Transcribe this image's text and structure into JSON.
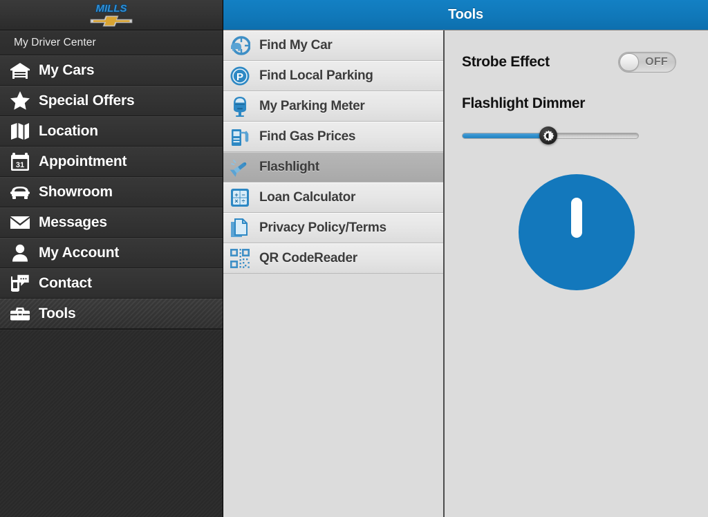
{
  "sidebar": {
    "logo": {
      "brand_text": "MILLS",
      "emblem": "chevrolet-bowtie-icon"
    },
    "header_label": "My Driver Center",
    "items": [
      {
        "label": "My Cars",
        "icon": "garage-icon",
        "selected": false
      },
      {
        "label": "Special Offers",
        "icon": "star-icon",
        "selected": false
      },
      {
        "label": "Location",
        "icon": "map-icon",
        "selected": false
      },
      {
        "label": "Appointment",
        "icon": "calendar-icon",
        "selected": false,
        "badge": "31"
      },
      {
        "label": "Showroom",
        "icon": "car-front-icon",
        "selected": false
      },
      {
        "label": "Messages",
        "icon": "envelope-icon",
        "selected": false
      },
      {
        "label": "My Account",
        "icon": "person-icon",
        "selected": false
      },
      {
        "label": "Contact",
        "icon": "phone-chat-icon",
        "selected": false
      },
      {
        "label": "Tools",
        "icon": "toolbox-icon",
        "selected": true
      }
    ]
  },
  "titlebar": {
    "title": "Tools"
  },
  "tools_list": {
    "items": [
      {
        "label": "Find My Car",
        "icon": "car-locate-icon",
        "selected": false
      },
      {
        "label": "Find Local Parking",
        "icon": "parking-p-icon",
        "selected": false
      },
      {
        "label": "My Parking Meter",
        "icon": "parking-meter-icon",
        "selected": false
      },
      {
        "label": "Find Gas Prices",
        "icon": "fuel-pump-icon",
        "selected": false
      },
      {
        "label": "Flashlight",
        "icon": "flashlight-icon",
        "selected": true
      },
      {
        "label": "Loan Calculator",
        "icon": "calculator-icon",
        "selected": false
      },
      {
        "label": "Privacy Policy/Terms",
        "icon": "documents-icon",
        "selected": false
      },
      {
        "label": "QR CodeReader",
        "icon": "qr-code-icon",
        "selected": false
      }
    ]
  },
  "detail": {
    "strobe": {
      "label": "Strobe Effect",
      "state_text": "OFF",
      "enabled": false
    },
    "dimmer": {
      "label": "Flashlight Dimmer",
      "value_percent": 49,
      "thumb_icon": "brightness-gear-icon"
    },
    "power": {
      "icon": "power-icon",
      "label": "",
      "on": false
    }
  },
  "colors": {
    "accent_blue": "#1177bb",
    "power_blue": "#1378bc",
    "sidebar_dark": "#2e2e2e",
    "pane_gray": "#dcdcdc",
    "selected_gray": "#b0b0b0",
    "logo_gold": "#d8a02a"
  }
}
